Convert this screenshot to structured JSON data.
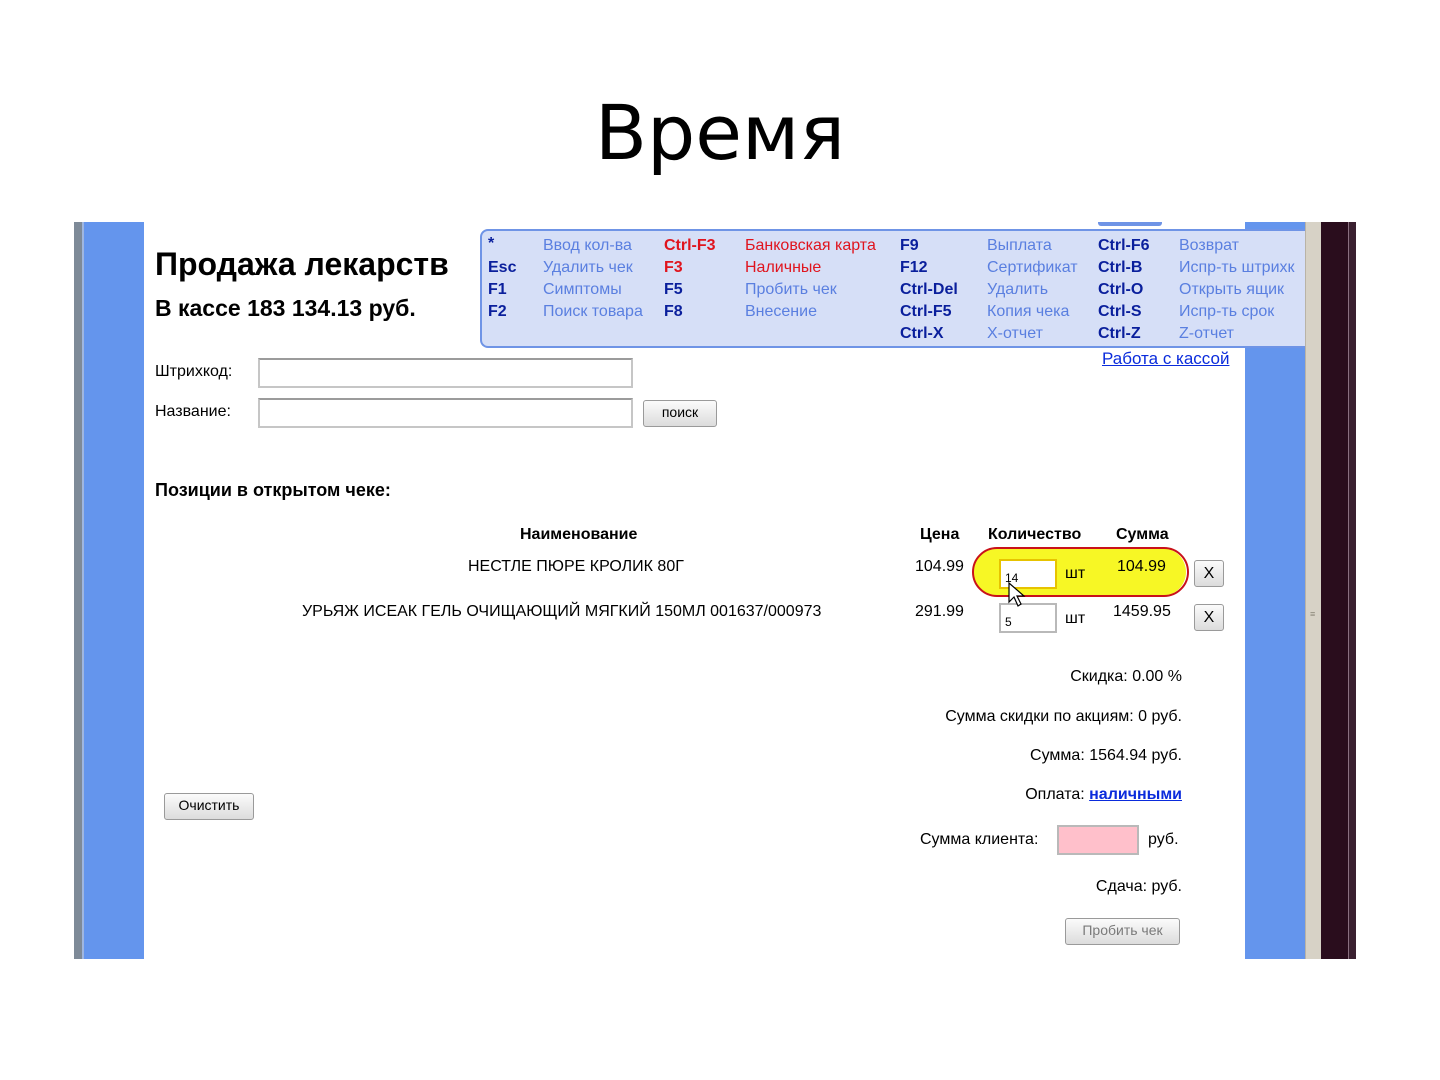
{
  "slide": {
    "title": "Время"
  },
  "page": {
    "title": "Продажа лекарств",
    "cash_text": "В кассе 183 134.13 руб."
  },
  "hotkeys": [
    {
      "key": "*",
      "label": "Ввод кол-ва"
    },
    {
      "key": "Esc",
      "label": "Удалить чек"
    },
    {
      "key": "F1",
      "label": "Симптомы"
    },
    {
      "key": "F2",
      "label": "Поиск товара"
    },
    {
      "key": "Ctrl-F3",
      "label": "Банковская карта"
    },
    {
      "key": "F3",
      "label": "Наличные"
    },
    {
      "key": "F5",
      "label": "Пробить чек"
    },
    {
      "key": "F8",
      "label": "Внесение"
    },
    {
      "key": "F9",
      "label": "Выплата"
    },
    {
      "key": "F12",
      "label": "Сертификат"
    },
    {
      "key": "Ctrl-Del",
      "label": "Удалить"
    },
    {
      "key": "Ctrl-F5",
      "label": "Копия чека"
    },
    {
      "key": "Ctrl-X",
      "label": "X-отчет"
    },
    {
      "key": "Ctrl-F6",
      "label": "Возврат"
    },
    {
      "key": "Ctrl-B",
      "label": "Испр-ть штрихк"
    },
    {
      "key": "Ctrl-O",
      "label": "Открыть ящик"
    },
    {
      "key": "Ctrl-S",
      "label": "Испр-ть срок"
    },
    {
      "key": "Ctrl-Z",
      "label": "Z-отчет"
    }
  ],
  "cash_link": "Работа с кассой",
  "form": {
    "barcode_label": "Штрихкод:",
    "barcode_value": "",
    "name_label": "Название:",
    "name_value": "",
    "search_button": "поиск"
  },
  "receipt": {
    "section_title": "Позиции в открытом чеке:",
    "columns": [
      "Наименование",
      "Цена",
      "Количество",
      "Сумма"
    ],
    "rows": [
      {
        "name": "НЕСТЛЕ ПЮРЕ КРОЛИК 80Г",
        "price": "104.99",
        "qty": "14",
        "unit": "шт",
        "sum": "104.99",
        "remove": "X"
      },
      {
        "name": "УРЬЯЖ ИСЕАК ГЕЛЬ ОЧИЩАЮЩИЙ МЯГКИЙ 150МЛ 001637/000973",
        "price": "291.99",
        "qty": "5",
        "unit": "шт",
        "sum": "1459.95",
        "remove": "X"
      }
    ]
  },
  "totals": {
    "discount": "Скидка: 0.00 %",
    "promo_discount": "Сумма скидки по акциям: 0 руб.",
    "sum": "Сумма: 1564.94 руб.",
    "payment_label": "Оплата:",
    "payment_link": "наличными",
    "client_sum_label": "Сумма клиента:",
    "client_sum_unit": "руб.",
    "change": "Сдача: руб.",
    "print_button": "Пробить чек"
  },
  "clear_button": "Очистить",
  "colors": {
    "page_bg": "#6495ed",
    "hotkeys_bg": "#d6dff7",
    "highlight": "#f7f725",
    "highlight_ring": "#c9121a",
    "client_input": "#ffc0cb",
    "link": "#0a2bdc",
    "hotkey_red": "#e0141e",
    "hotkey_blue": "#0a1f9c"
  }
}
